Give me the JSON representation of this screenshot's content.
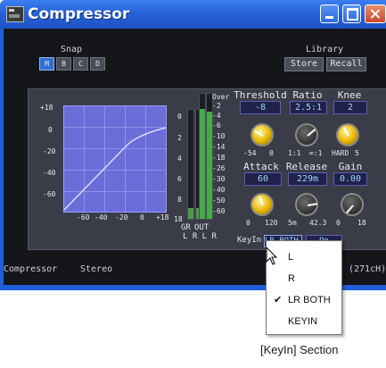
{
  "window": {
    "title": "Compressor"
  },
  "snap": {
    "label": "Snap",
    "buttons": [
      "M",
      "B",
      "C",
      "D"
    ]
  },
  "library": {
    "label": "Library",
    "store": "Store",
    "recall": "Recall"
  },
  "graph": {
    "y_ticks": [
      "+18",
      "0",
      "-20",
      "-40",
      "-60"
    ],
    "x_ticks": [
      "-60",
      "-40",
      "-20",
      "0",
      "+18"
    ]
  },
  "meter_scale": [
    "Over",
    "-2",
    "-4",
    "-6",
    "-10",
    "-14",
    "-18",
    "-26",
    "-30",
    "-40",
    "-50",
    "-60"
  ],
  "gr_scale": [
    "0",
    "2",
    "4",
    "6",
    "8",
    "18"
  ],
  "meter_labels": {
    "gr": "GR",
    "out": "OUT",
    "lr": "L R L R"
  },
  "params": {
    "threshold": {
      "label": "Threshold",
      "value": "-8",
      "min": "-54",
      "max": "0"
    },
    "ratio": {
      "label": "Ratio",
      "value": "2.5:1",
      "min": "1:1",
      "max": "∞:1"
    },
    "knee": {
      "label": "Knee",
      "value": "2",
      "min": "HARD",
      "max": "5"
    },
    "attack": {
      "label": "Attack",
      "value": "60",
      "min": "0",
      "max": "120"
    },
    "release": {
      "label": "Release",
      "value": "229m",
      "min": "5m",
      "max": "42.3"
    },
    "gain": {
      "label": "Gain",
      "value": "0.00",
      "min": "0",
      "max": "18"
    }
  },
  "keyin": {
    "label": "KeyIn",
    "value": "LR BOTH",
    "on": "On"
  },
  "status": {
    "mode": "Compressor",
    "channels": "Stereo",
    "right": "(271cH)"
  },
  "menu": {
    "items": [
      "L",
      "R",
      "LR BOTH",
      "KEYIN"
    ],
    "checked": "LR BOTH"
  },
  "caption": "[KeyIn] Section",
  "colors": {
    "title_bar": "#2762d8",
    "graph": "#6b6dd8",
    "knob_gold": "#e6b400",
    "value_text": "#9fd1ff"
  }
}
